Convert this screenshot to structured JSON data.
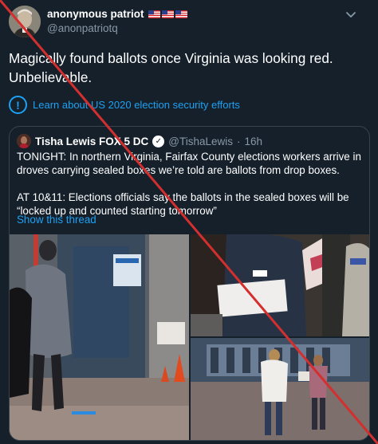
{
  "tweet": {
    "display_name": "anonymous patriot",
    "flag_icons": [
      "us-flag-icon",
      "us-flag-icon",
      "us-flag-icon"
    ],
    "handle": "@anonpatriotq",
    "text": "Magically found ballots once Virginia was looking red. Unbelievable.",
    "info_link": "Learn about US 2020 election security efforts"
  },
  "quote": {
    "display_name": "Tisha Lewis FOX 5 DC",
    "handle": "@TishaLewis",
    "separator": "·",
    "time": "16h",
    "paragraph_1": "TONIGHT: In northern Virginia, Fairfax County elections workers arrive in droves carrying sealed boxes we’re told are ballots from drop boxes.",
    "paragraph_2": "AT 10&11: Elections officials say the ballots in the sealed boxes will be “locked up and counted starting tomorrow”",
    "show_thread": "Show this thread"
  },
  "colors": {
    "background": "#15202b",
    "link": "#1da1f2",
    "secondary_text": "#8899a6",
    "border": "#38444d",
    "overlay_cross": "#d32f2f"
  }
}
